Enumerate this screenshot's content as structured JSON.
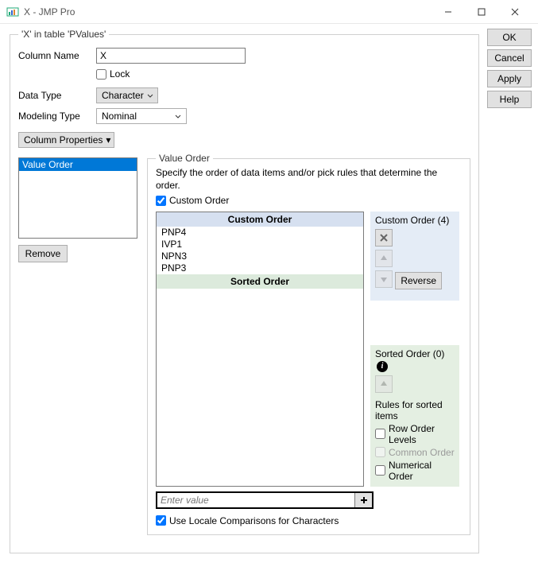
{
  "window": {
    "title": "X - JMP Pro"
  },
  "buttons": {
    "ok": "OK",
    "cancel": "Cancel",
    "apply": "Apply",
    "help": "Help"
  },
  "group_legend": "'X' in table 'PValues'",
  "labels": {
    "column_name": "Column Name",
    "lock": "Lock",
    "data_type": "Data Type",
    "modeling_type": "Modeling Type",
    "column_properties": "Column Properties",
    "remove": "Remove"
  },
  "values": {
    "column_name": "X",
    "data_type": "Character",
    "modeling_type": "Nominal"
  },
  "properties_list": [
    "Value Order"
  ],
  "properties_selected": "Value Order",
  "value_order": {
    "legend": "Value Order",
    "description": "Specify the order of data items and/or pick rules that determine the order.",
    "custom_order_check": "Custom Order",
    "headers": {
      "custom": "Custom Order",
      "sorted": "Sorted Order"
    },
    "items": [
      "PNP4",
      "IVP1",
      "NPN3",
      "PNP3"
    ],
    "custom_panel": {
      "title": "Custom Order (4)",
      "reverse": "Reverse"
    },
    "sorted_panel": {
      "title": "Sorted Order (0)",
      "rules_label": "Rules for sorted items",
      "row_order": "Row Order Levels",
      "common_order": "Common Order",
      "numerical_order": "Numerical Order"
    },
    "enter_placeholder": "Enter value",
    "locale_label": "Use Locale Comparisons for Characters"
  }
}
